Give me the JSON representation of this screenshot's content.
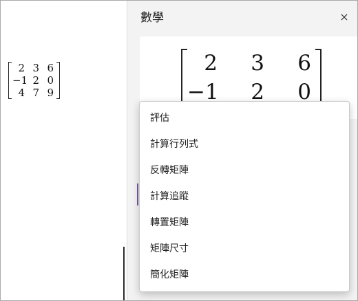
{
  "canvas": {
    "matrix": [
      [
        "2",
        "3",
        "6"
      ],
      [
        "−1",
        "2",
        "0"
      ],
      [
        "4",
        "7",
        "9"
      ]
    ]
  },
  "pane": {
    "title": "數學",
    "close_icon": "×",
    "preview_matrix": [
      [
        "2",
        "3",
        "6"
      ],
      [
        "−1",
        "2",
        "0"
      ]
    ]
  },
  "menu": {
    "items": [
      "評估",
      "計算行列式",
      "反轉矩陣",
      "計算追蹤",
      "轉置矩陣",
      "矩陣尺寸",
      "簡化矩陣"
    ]
  },
  "colors": {
    "accent": "#7a5aa6",
    "pane_bg": "#f3f3f3"
  }
}
